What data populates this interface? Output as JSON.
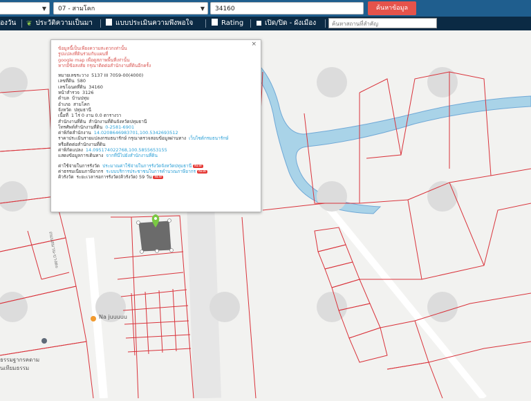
{
  "topbar": {
    "select1": "",
    "select2": "07 - สามโคก",
    "parcel_input": "34160",
    "search_label": "ค้นหาข้อมูล"
  },
  "menu": {
    "item1": "องวัน",
    "item2": "ประวัติความเป็นมา",
    "item3": "แบบประเมินความพึงพอใจ",
    "item4": "Rating",
    "item5": "เปิด/ปิด - ผังเมือง",
    "filter_placeholder": "ค้นหาสถานที่สำคัญ"
  },
  "popup": {
    "warning_lines": [
      "ข้อมูลนี้เป็นเพียงความสะดวกเท่านั้น",
      "รูปแปลงที่ดินร่วมกับแผนที่",
      "google map เพื่อดูสภาพพื้นที่เท่านั้น",
      "หากมีข้อสงสัย กรุณาติดต่อสำนักงานที่ดินอีกครั้ง"
    ],
    "sheet_label": "หมายเลขระวาง",
    "sheet_value": "5137 III 7059-00(4000)",
    "land_no_label": "เลขที่ดิน",
    "land_no_value": "580",
    "deed_label": "เลขโฉนดที่ดิน",
    "deed_value": "34160",
    "survey_label": "หน้าสำรวจ",
    "survey_value": "3126",
    "tambon_label": "ตำบล",
    "tambon_value": "บ้านปทุม",
    "amphoe_label": "อำเภอ",
    "amphoe_value": "สามโคก",
    "province_label": "จังหวัด",
    "province_value": "ปทุมธานี",
    "area_label": "เนื้อที่",
    "area_value": "1 ไร่ 0 งาน 0.0 ตารางวา",
    "office_label": "สำนักงานที่ดิน",
    "office_value": "สำนักงานที่ดินจังหวัดปทุมธานี",
    "phone_label": "โทรศัพท์สำนักงานที่ดิน",
    "phone_value": "0-2581-6901",
    "office_coord_label": "ค่าพิกัดสำนักงาน",
    "office_coord_value": "14.0208646983701,100.5342693512",
    "appraisal_label": "ราคาประเมินรายแปลงกรมธนารักษ์ กรุณาตรวจสอบข้อมูลผ่านทาง",
    "appraisal_link": "เว็บไซต์กรมธนารักษ์",
    "appraisal_tail": "หรือติดต่อสำนักงานที่ดิน",
    "parcel_coord_label": "ค่าพิกัดแปลง",
    "parcel_coord_value": "14.095174022768,100.5855653155",
    "route_label": "แสดงข้อมูลการเดินทาง",
    "route_link": "จากที่นี่ไปยังสำนักงานที่ดิน",
    "fee_label": "ค่าใช้จ่ายในการรังวัด",
    "fee_link": "ประมาณค่าใช้จ่ายในการรังวัดจังหวัดปทุมธานี",
    "tax_label": "ค่าธรรมเนียมภาษีอากร",
    "tax_link": "ระบบบริการประชาชนในการคำนวณภาษีอากร",
    "queue_label": "คิวรังวัด",
    "queue_value": "ระยะเวลารอการรังวัด(คิวรังวัด) 59 วัน",
    "new_badge": "NEW",
    "close": "×"
  },
  "map": {
    "poi1": "Na juuuuu",
    "poi2": "ธรรมฐากรคดาม",
    "poi3": "นเทียมธรรม",
    "road_label": "ถนนสมาน-บางตะ"
  },
  "colors": {
    "topbar": "#1f5e8e",
    "menubar": "#0b2a44",
    "parcel_line": "#d9323a",
    "river": "#a9d3e8",
    "highlight": "#6b6b6b",
    "accent_button": "#e5534b"
  }
}
